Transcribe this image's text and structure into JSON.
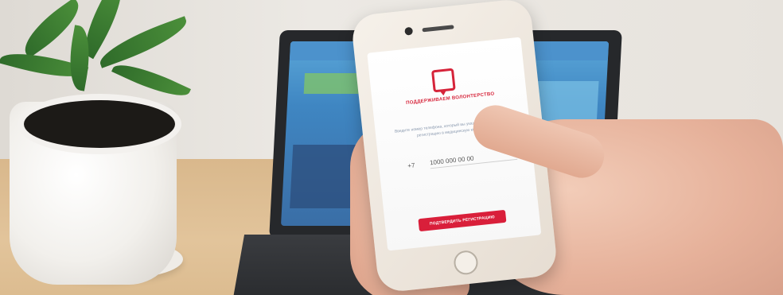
{
  "app_screen": {
    "name": "ПОДДЕРЖИВАЕМ ВОЛОНТЕРСТВО",
    "description": "Введите номер телефона, который вы указали в заявлении на регистрацию в медицинскую комиссию",
    "phone_prefix": "+7",
    "phone_value": "1000 000 00 00",
    "confirm_label": "ПОДТВЕРДИТЬ РЕГИСТРАЦИЮ"
  },
  "colors": {
    "accent": "#d91f3a",
    "text_muted": "#8c9bb0"
  }
}
